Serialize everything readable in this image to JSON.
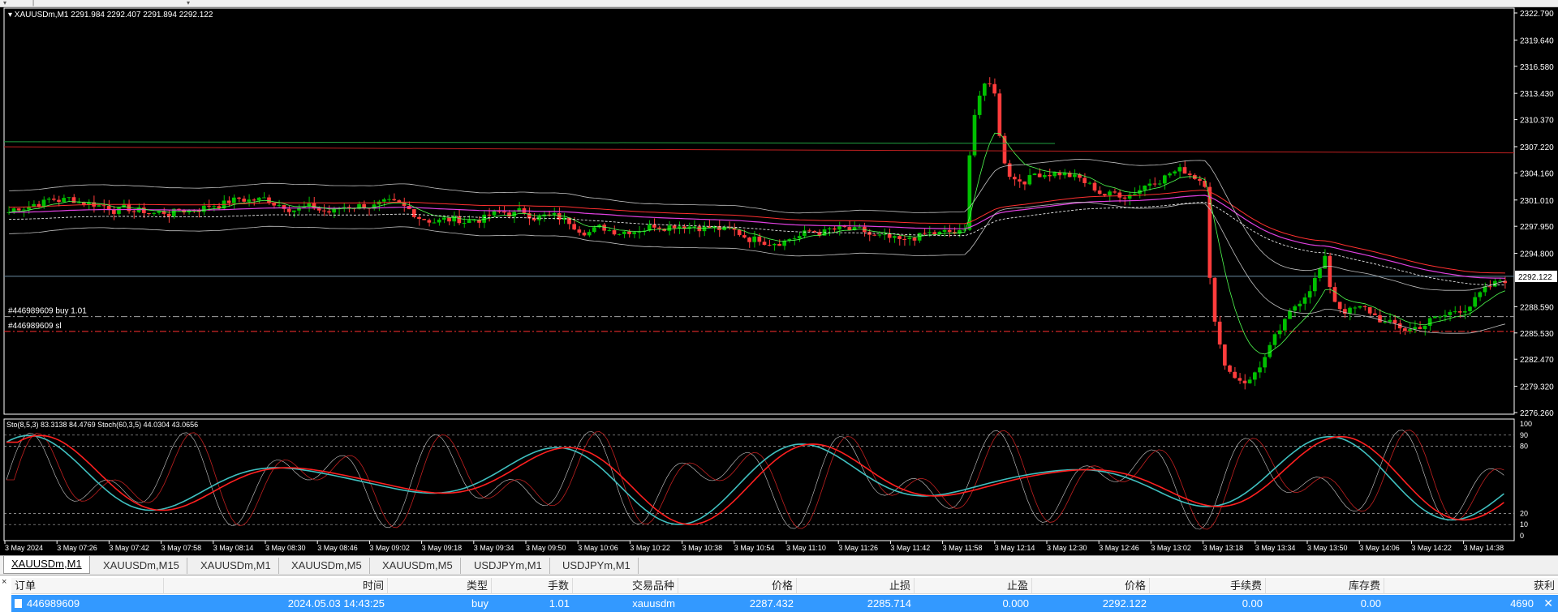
{
  "main_chart": {
    "symbol_line": "XAUUSDm,M1  2291.984 2292.407 2291.894 2292.122",
    "price_axis": [
      "2322.790",
      "2319.640",
      "2316.580",
      "2313.430",
      "2310.370",
      "2307.220",
      "2304.160",
      "2301.010",
      "2297.950",
      "2294.800",
      "2292.122",
      "2288.590",
      "2285.530",
      "2282.470",
      "2279.320",
      "2276.260"
    ],
    "current_price": "2292.122",
    "order_label_buy": "#446989609 buy 1.01",
    "order_label_sl": "#446989609 sl",
    "colors": {
      "bull": "#00c000",
      "bear": "#ff3c3c",
      "background": "#000000",
      "grid_text": "#ffffff"
    }
  },
  "stochastic": {
    "label": "Sto(8,5,3) 83.3138 84.4769  Stoch(60,3,5) 44.0304 43.0656",
    "levels": [
      "100",
      "90",
      "80",
      "20",
      "10",
      "0"
    ]
  },
  "time_axis": [
    "3 May 2024",
    "3 May 07:26",
    "3 May 07:42",
    "3 May 07:58",
    "3 May 08:14",
    "3 May 08:30",
    "3 May 08:46",
    "3 May 09:02",
    "3 May 09:18",
    "3 May 09:34",
    "3 May 09:50",
    "3 May 10:06",
    "3 May 10:22",
    "3 May 10:38",
    "3 May 10:54",
    "3 May 11:10",
    "3 May 11:26",
    "3 May 11:42",
    "3 May 11:58",
    "3 May 12:14",
    "3 May 12:30",
    "3 May 12:46",
    "3 May 13:02",
    "3 May 13:18",
    "3 May 13:34",
    "3 May 13:50",
    "3 May 14:06",
    "3 May 14:22",
    "3 May 14:38"
  ],
  "tabs": [
    "XAUUSDm,M1",
    "XAUUSDm,M15",
    "XAUUSDm,M1",
    "XAUUSDm,M5",
    "XAUUSDm,M5",
    "USDJPYm,M1",
    "USDJPYm,M1"
  ],
  "terminal": {
    "close_glyph": "×",
    "headers": [
      "订单",
      "时间",
      "类型",
      "手数",
      "交易品种",
      "价格",
      "止损",
      "止盈",
      "价格",
      "手续费",
      "库存费",
      "获利"
    ],
    "row": {
      "order": "446989609",
      "time": "2024.05.03 14:43:25",
      "type": "buy",
      "lots": "1.01",
      "symbol": "xauusdm",
      "open_price": "2287.432",
      "sl": "2285.714",
      "tp": "0.000",
      "price": "2292.122",
      "commission": "0.00",
      "swap": "0.00",
      "profit": "4690",
      "close_glyph": "✕"
    }
  }
}
